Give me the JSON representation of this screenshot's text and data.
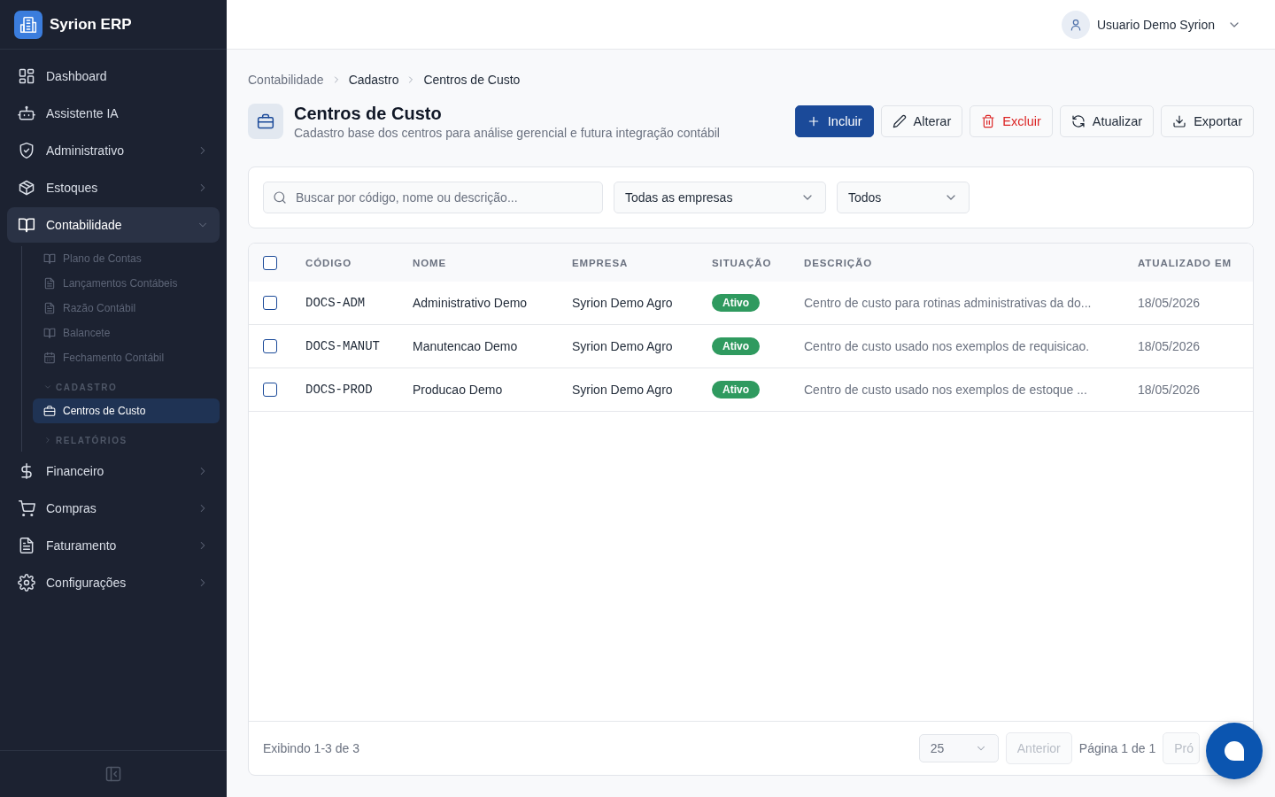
{
  "app": {
    "name": "Syrion ERP"
  },
  "sidebar": {
    "items": [
      {
        "kind": "link",
        "label": "Dashboard",
        "selected": false
      },
      {
        "kind": "link",
        "label": "Assistente IA",
        "selected": false
      },
      {
        "kind": "menu",
        "label": "Administrativo",
        "selected": false,
        "expanded": false
      },
      {
        "kind": "menu",
        "label": "Estoques",
        "selected": false,
        "expanded": false
      },
      {
        "kind": "menu",
        "label": "Contabilidade",
        "selected": true,
        "expanded": true,
        "children": [
          {
            "kind": "link",
            "label": "Plano de Contas",
            "selected": false
          },
          {
            "kind": "link",
            "label": "Lançamentos Contábeis",
            "selected": false
          },
          {
            "kind": "link",
            "label": "Razão Contábil",
            "selected": false
          },
          {
            "kind": "link",
            "label": "Balancete",
            "selected": false
          },
          {
            "kind": "link",
            "label": "Fechamento Contábil",
            "selected": false
          },
          {
            "kind": "group",
            "label": "CADASTRO",
            "expanded": true,
            "children": [
              {
                "kind": "link",
                "label": "Centros de Custo",
                "selected": true
              }
            ]
          },
          {
            "kind": "group",
            "label": "RELATÓRIOS",
            "expanded": false
          }
        ]
      },
      {
        "kind": "menu",
        "label": "Financeiro",
        "selected": false,
        "expanded": false
      },
      {
        "kind": "menu",
        "label": "Compras",
        "selected": false,
        "expanded": false
      },
      {
        "kind": "menu",
        "label": "Faturamento",
        "selected": false,
        "expanded": false
      },
      {
        "kind": "menu",
        "label": "Configurações",
        "selected": false,
        "expanded": false
      }
    ]
  },
  "topbar": {
    "user": "Usuario Demo Syrion"
  },
  "breadcrumb": [
    "Contabilidade",
    "Cadastro",
    "Centros de Custo"
  ],
  "page": {
    "title": "Centros de Custo",
    "subtitle": "Cadastro base dos centros para análise gerencial e futura integração contábil"
  },
  "toolbar": [
    {
      "label": "Incluir",
      "kind": "primary"
    },
    {
      "label": "Alterar",
      "kind": "default"
    },
    {
      "label": "Excluir",
      "kind": "danger"
    },
    {
      "label": "Atualizar",
      "kind": "default"
    },
    {
      "label": "Exportar",
      "kind": "default"
    }
  ],
  "filters": {
    "search": {
      "placeholder": "Buscar por código, nome ou descrição..."
    },
    "company": "Todas as empresas",
    "status": "Todos"
  },
  "table": {
    "select_all": {
      "checked": false
    },
    "columns": [
      "CÓDIGO",
      "NOME",
      "EMPRESA",
      "SITUAÇÃO",
      "DESCRIÇÃO",
      "ATUALIZADO EM"
    ],
    "rows": [
      {
        "checked": false,
        "code": "DOCS-ADM",
        "name": "Administrativo Demo",
        "company": "Syrion Demo Agro",
        "status": "Ativo",
        "description": "Centro de custo para rotinas administrativas da do...",
        "updated": "18/05/2026"
      },
      {
        "checked": false,
        "code": "DOCS-MANUT",
        "name": "Manutencao Demo",
        "company": "Syrion Demo Agro",
        "status": "Ativo",
        "description": "Centro de custo usado nos exemplos de requisicao.",
        "updated": "18/05/2026"
      },
      {
        "checked": false,
        "code": "DOCS-PROD",
        "name": "Producao Demo",
        "company": "Syrion Demo Agro",
        "status": "Ativo",
        "description": "Centro de custo usado nos exemplos de estoque ...",
        "updated": "18/05/2026"
      }
    ]
  },
  "footer": {
    "summary": "Exibindo 1-3 de 3",
    "page_size": "25",
    "previous": {
      "label": "Anterior",
      "disabled": true
    },
    "page_info": "Página 1 de 1",
    "next": {
      "label": "Pró",
      "disabled": true
    }
  }
}
